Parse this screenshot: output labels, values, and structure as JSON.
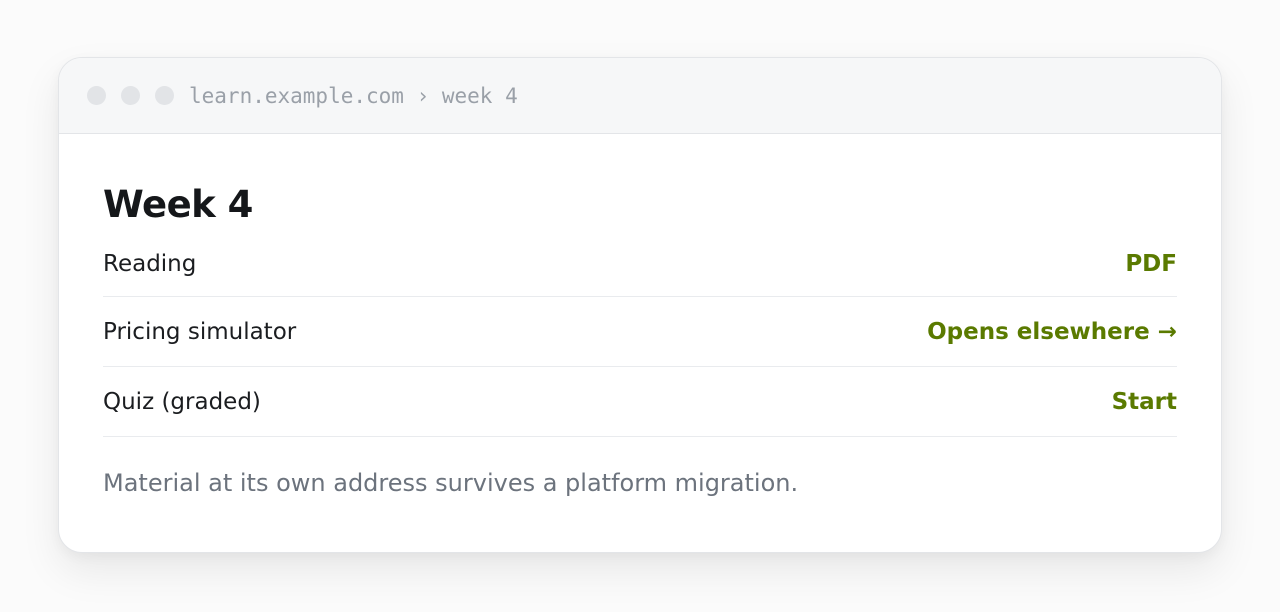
{
  "browser": {
    "url_text": "learn.example.com › week 4"
  },
  "page": {
    "title": "Week 4",
    "rows": [
      {
        "label": "Reading",
        "action": "PDF"
      },
      {
        "label": "Pricing simulator",
        "action": "Opens elsewhere →"
      },
      {
        "label": "Quiz (graded)",
        "action": "Start"
      }
    ],
    "note": "Material at its own address survives a platform migration."
  },
  "colors": {
    "accent": "#5a7a00",
    "text": "#1b1d20",
    "muted": "#6c737d"
  }
}
